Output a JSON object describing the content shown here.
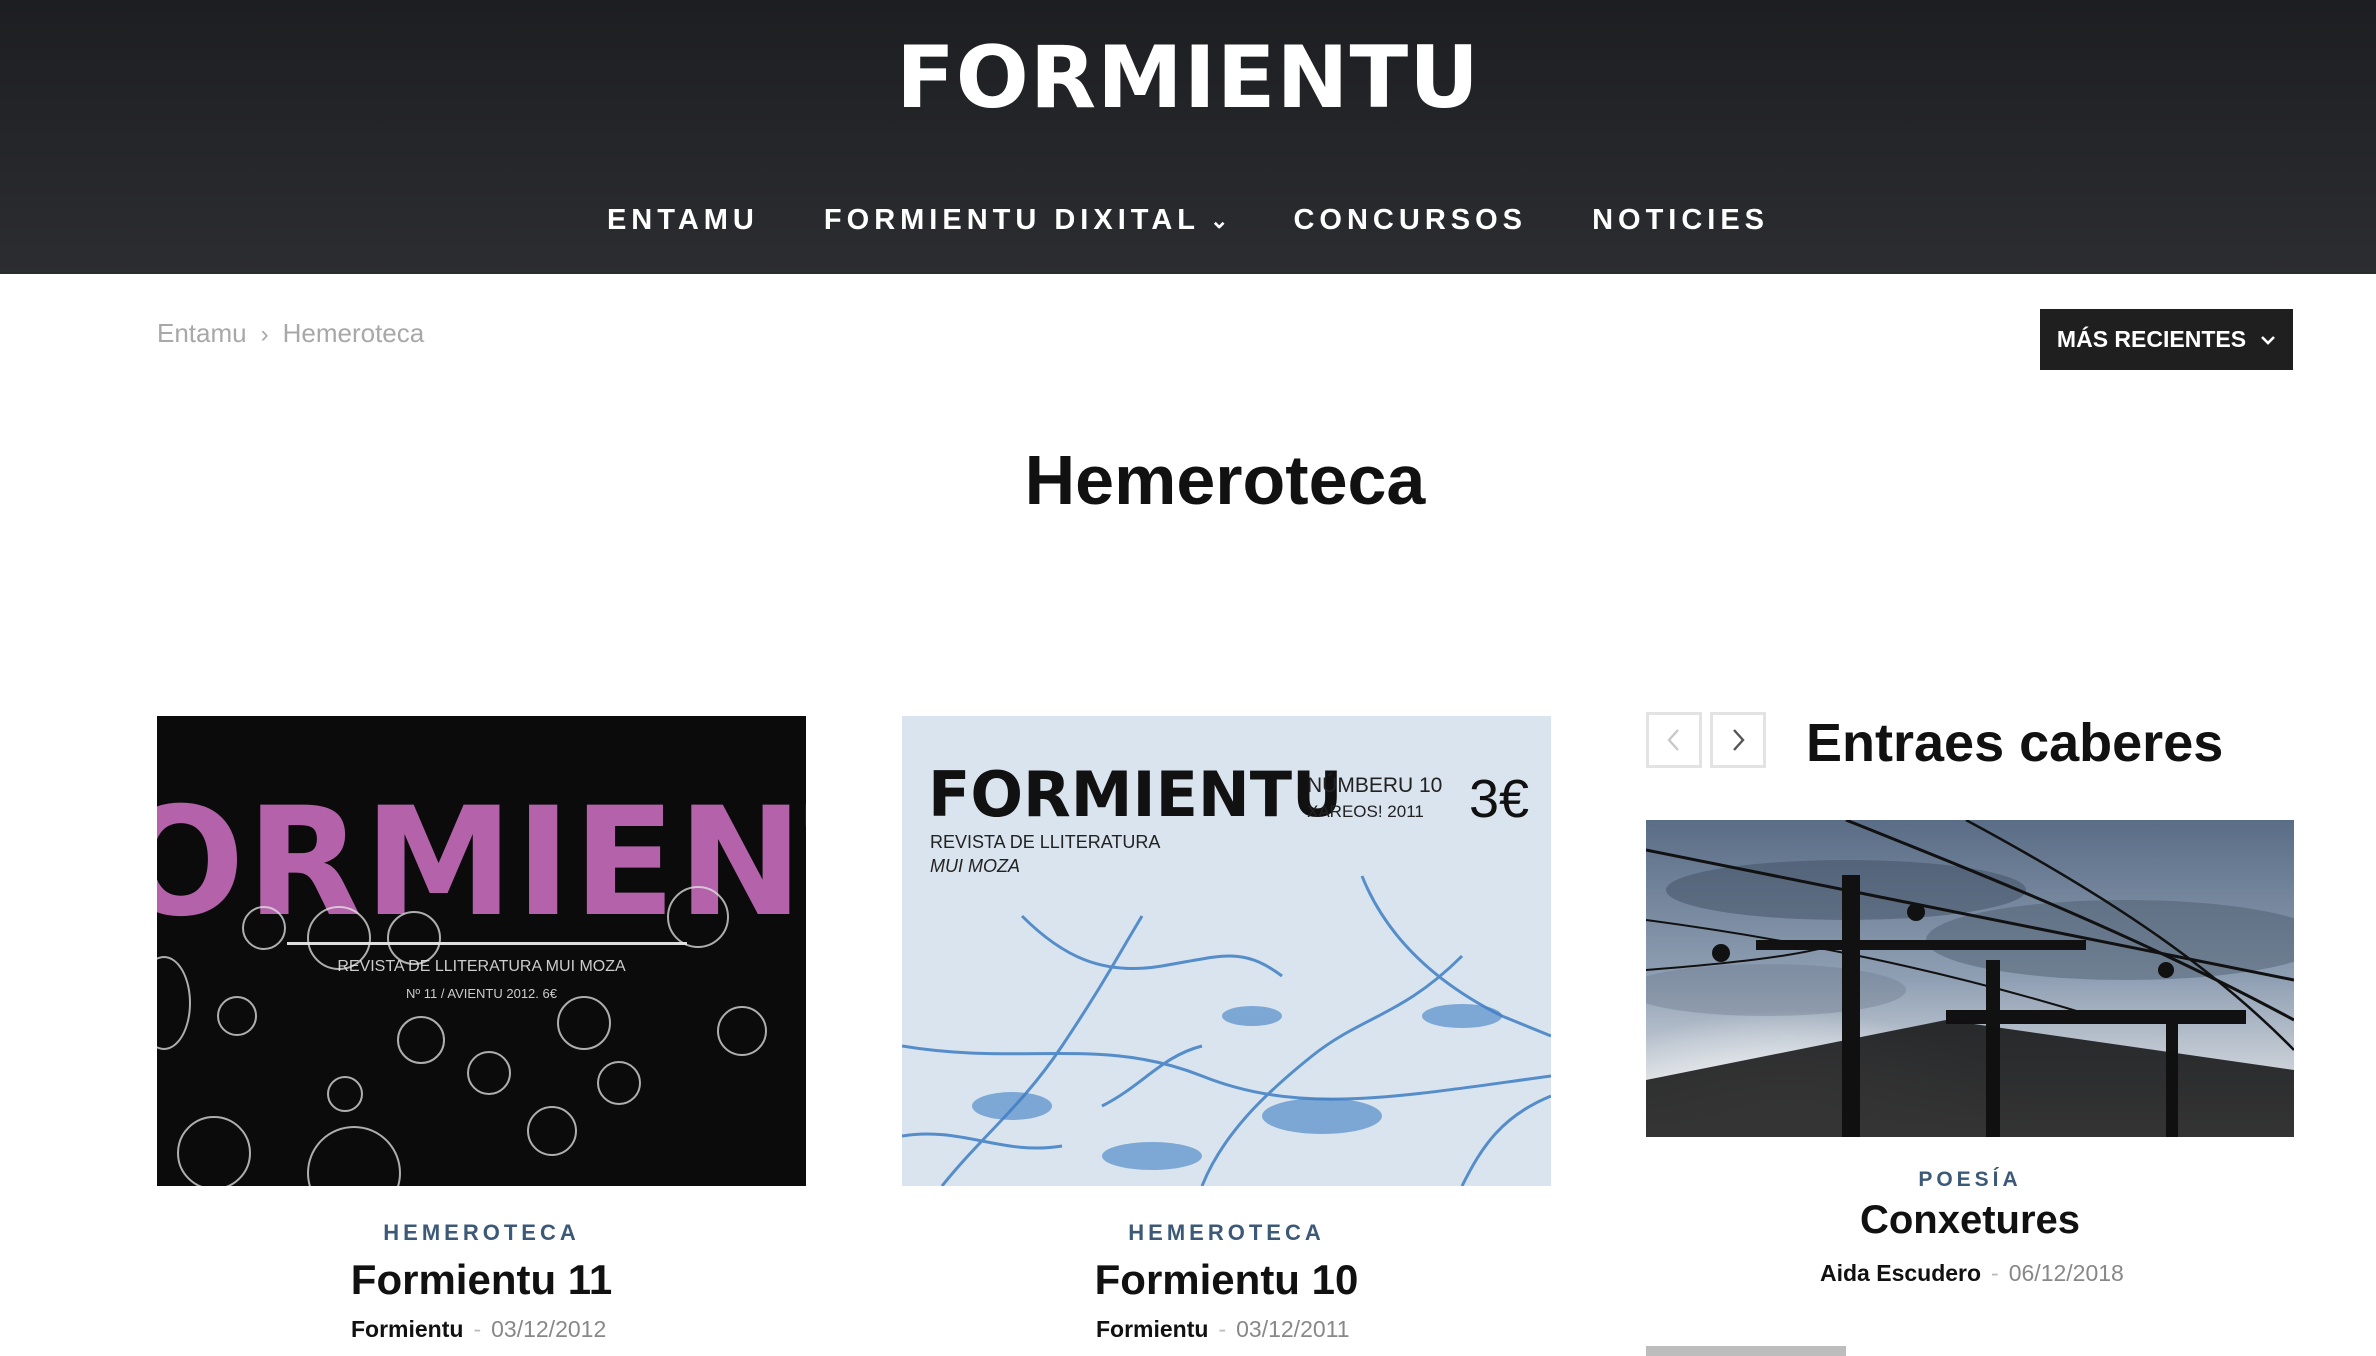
{
  "site": {
    "logo_text": "FORMIENTU"
  },
  "nav": {
    "items": [
      "ENTAMU",
      "FORMIENTU DIXITAL",
      "CONCURSOS",
      "NOTICIES"
    ],
    "dropdown_icon": "chevron-down-icon"
  },
  "breadcrumb": {
    "home": "Entamu",
    "separator": "›",
    "current": "Hemeroteca"
  },
  "sort": {
    "label": "MÁS RECIENTES",
    "icon": "chevron-down-icon"
  },
  "page": {
    "title": "Hemeroteca"
  },
  "posts": [
    {
      "category": "HEMEROTECA",
      "title": "Formientu 11",
      "author": "Formientu",
      "date": "03/12/2012",
      "cover": {
        "big_word": "ORMIENT",
        "subtitle": "REVISTA DE LLITERATURA MUI MOZA",
        "issue_line": "Nº 11 / AVIENTU 2012. 6€"
      }
    },
    {
      "category": "HEMEROTECA",
      "title": "Formientu 10",
      "author": "Formientu",
      "date": "03/12/2011",
      "cover": {
        "big_word": "FORMIENTU",
        "number": "NÚMBERU 10",
        "issue_date": "XAREOS! 2011",
        "price": "3€",
        "subtitle": "REVISTA DE LLITERATURA",
        "subtitle2": "MUI MOZA"
      }
    }
  ],
  "sidebar": {
    "title": "Entraes caberes",
    "prev_icon": "chevron-left-icon",
    "next_icon": "chevron-right-icon",
    "post": {
      "category": "POESÍA",
      "title": "Conxetures",
      "author": "Aida Escudero",
      "date": "06/12/2018"
    }
  },
  "colors": {
    "header_bg": "#222326",
    "category_text": "#3c5a78",
    "button_bg": "#1f1f1f",
    "cover_pink": "#b463ab",
    "cover_blue": "#3f7fc4"
  },
  "meta_separator": "-"
}
